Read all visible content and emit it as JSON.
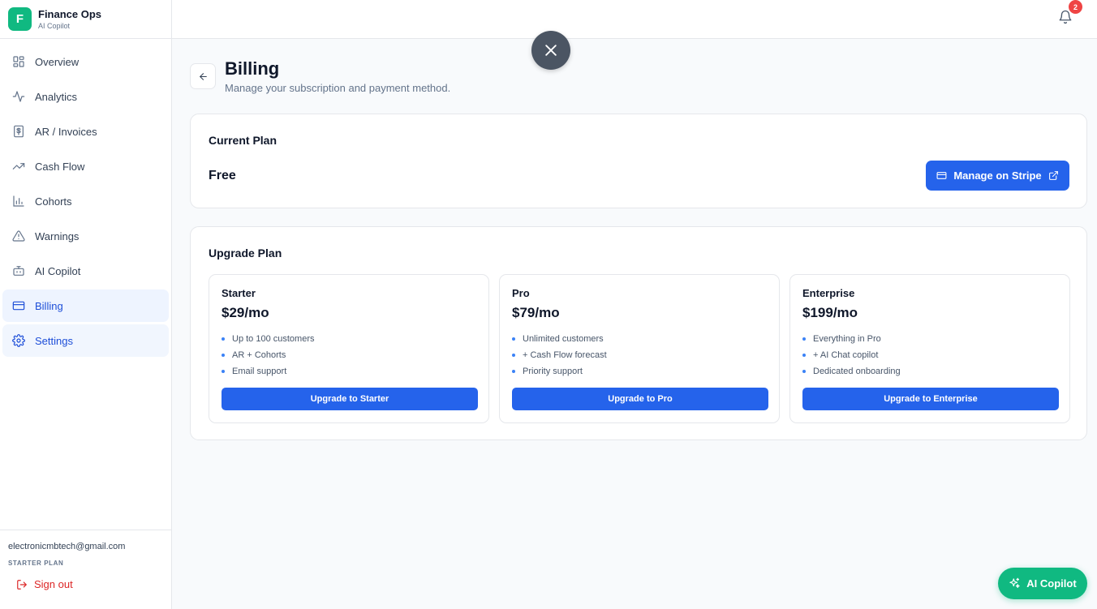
{
  "brand": {
    "logo_letter": "F",
    "name": "Finance Ops",
    "subtitle": "AI Copilot"
  },
  "nav": [
    {
      "label": "Overview",
      "icon": "grid-icon"
    },
    {
      "label": "Analytics",
      "icon": "activity-icon"
    },
    {
      "label": "AR / Invoices",
      "icon": "invoice-icon"
    },
    {
      "label": "Cash Flow",
      "icon": "trending-up-icon"
    },
    {
      "label": "Cohorts",
      "icon": "bar-chart-icon"
    },
    {
      "label": "Warnings",
      "icon": "warning-icon"
    },
    {
      "label": "AI Copilot",
      "icon": "bot-icon"
    },
    {
      "label": "Billing",
      "icon": "credit-card-icon",
      "active": true
    },
    {
      "label": "Settings",
      "icon": "gear-icon"
    }
  ],
  "user": {
    "email": "electronicmbtech@gmail.com",
    "plan": "STARTER PLAN",
    "signout_label": "Sign out"
  },
  "notifications": {
    "count": "2"
  },
  "page": {
    "title": "Billing",
    "subtitle": "Manage your subscription and payment method."
  },
  "current_plan": {
    "heading": "Current Plan",
    "name": "Free",
    "manage_label": "Manage on Stripe"
  },
  "upgrade": {
    "heading": "Upgrade Plan",
    "tiers": [
      {
        "name": "Starter",
        "price": "$29/mo",
        "features": [
          "Up to 100 customers",
          "AR + Cohorts",
          "Email support"
        ],
        "button": "Upgrade to Starter"
      },
      {
        "name": "Pro",
        "price": "$79/mo",
        "features": [
          "Unlimited customers",
          "+ Cash Flow forecast",
          "Priority support"
        ],
        "button": "Upgrade to Pro"
      },
      {
        "name": "Enterprise",
        "price": "$199/mo",
        "features": [
          "Everything in Pro",
          "+ AI Chat copilot",
          "Dedicated onboarding"
        ],
        "button": "Upgrade to Enterprise"
      }
    ]
  },
  "copilot_fab": {
    "label": "AI Copilot"
  },
  "colors": {
    "primary": "#2563eb",
    "brand_green": "#10b981",
    "danger": "#dc2626",
    "badge": "#ef4444"
  }
}
